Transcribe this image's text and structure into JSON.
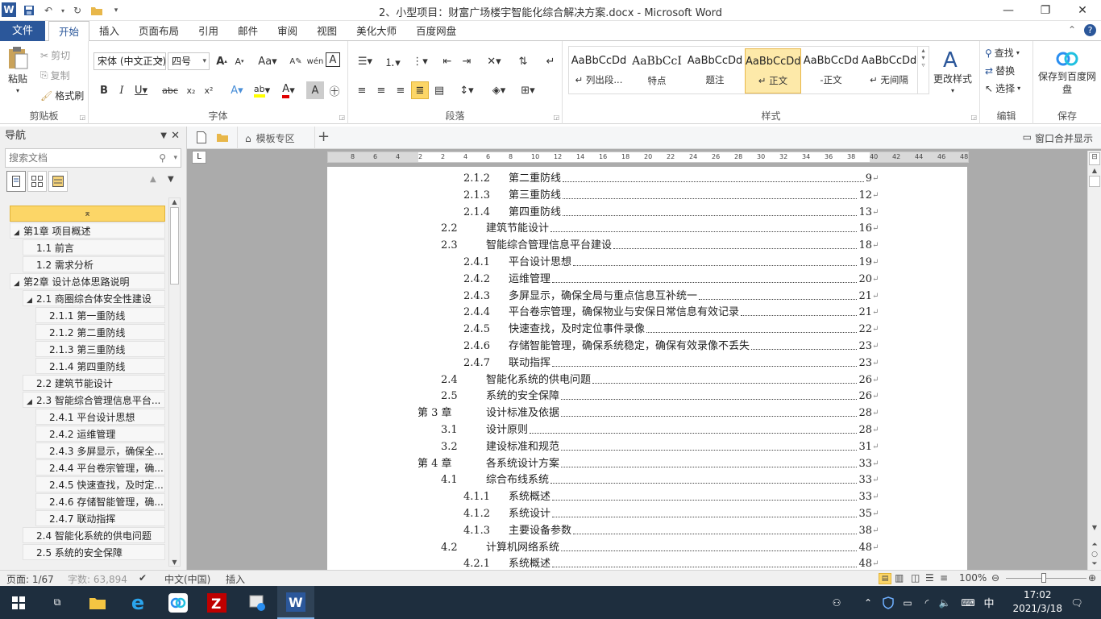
{
  "window": {
    "title": "2、小型项目：财富广场楼宇智能化综合解决方案.docx - Microsoft Word",
    "app_icon": "W"
  },
  "tabs": {
    "file": "文件",
    "items": [
      "开始",
      "插入",
      "页面布局",
      "引用",
      "邮件",
      "审阅",
      "视图",
      "美化大师",
      "百度网盘"
    ],
    "active": "开始"
  },
  "ribbon": {
    "clipboard": {
      "label": "剪贴板",
      "paste": "粘贴",
      "cut": "剪切",
      "copy": "复制",
      "format_painter": "格式刷"
    },
    "font": {
      "label": "字体",
      "name": "宋体 (中文正文)",
      "size": "四号"
    },
    "paragraph": {
      "label": "段落"
    },
    "styles": {
      "label": "样式",
      "items": [
        {
          "preview": "AaBbCcDd",
          "name": "↵ 列出段..."
        },
        {
          "preview": "AaBbCcI",
          "name": "特点"
        },
        {
          "preview": "AaBbCcDd",
          "name": "题注"
        },
        {
          "preview": "AaBbCcDd",
          "name": "↵ 正文"
        },
        {
          "preview": "AaBbCcDd",
          "name": "-正文"
        },
        {
          "preview": "AaBbCcDd",
          "name": "↵ 无间隔"
        }
      ],
      "change_styles": "更改样式"
    },
    "editing": {
      "label": "编辑",
      "find": "查找",
      "replace": "替换",
      "select": "选择"
    },
    "save": {
      "label": "保存",
      "save_to_baidu": "保存到百度网盘"
    }
  },
  "nav": {
    "title": "导航",
    "search_placeholder": "搜索文档",
    "items": [
      {
        "level": 1,
        "text": "第1章 项目概述",
        "expanded": true
      },
      {
        "level": 2,
        "text": "1.1 前言"
      },
      {
        "level": 2,
        "text": "1.2 需求分析"
      },
      {
        "level": 1,
        "text": "第2章 设计总体思路说明",
        "expanded": true
      },
      {
        "level": 2,
        "text": "2.1 商圈综合体安全性建设",
        "expanded": true
      },
      {
        "level": 3,
        "text": "2.1.1 第一重防线"
      },
      {
        "level": 3,
        "text": "2.1.2 第二重防线"
      },
      {
        "level": 3,
        "text": "2.1.3 第三重防线"
      },
      {
        "level": 3,
        "text": "2.1.4 第四重防线"
      },
      {
        "level": 2,
        "text": "2.2 建筑节能设计"
      },
      {
        "level": 2,
        "text": "2.3 智能综合管理信息平台...",
        "expanded": true
      },
      {
        "level": 3,
        "text": "2.4.1 平台设计思想"
      },
      {
        "level": 3,
        "text": "2.4.2 运维管理"
      },
      {
        "level": 3,
        "text": "2.4.3 多屏显示，确保全..."
      },
      {
        "level": 3,
        "text": "2.4.4 平台卷宗管理，确..."
      },
      {
        "level": 3,
        "text": "2.4.5 快速查找，及时定..."
      },
      {
        "level": 3,
        "text": "2.4.6 存储智能管理，确..."
      },
      {
        "level": 3,
        "text": "2.4.7 联动指挥"
      },
      {
        "level": 2,
        "text": "2.4 智能化系统的供电问题"
      },
      {
        "level": 2,
        "text": "2.5 系统的安全保障"
      }
    ]
  },
  "doc_tabs": {
    "template": "模板专区",
    "window_merge": "窗口合并显示"
  },
  "toc": [
    {
      "level": 3,
      "num": "2.1.2",
      "title": "第二重防线",
      "page": "9"
    },
    {
      "level": 3,
      "num": "2.1.3",
      "title": "第三重防线",
      "page": "12"
    },
    {
      "level": 3,
      "num": "2.1.4",
      "title": "第四重防线",
      "page": "13"
    },
    {
      "level": 2,
      "num": "2.2",
      "title": "建筑节能设计",
      "page": "16"
    },
    {
      "level": 2,
      "num": "2.3",
      "title": "智能综合管理信息平台建设",
      "page": "18"
    },
    {
      "level": 3,
      "num": "2.4.1",
      "title": "平台设计思想",
      "page": "19"
    },
    {
      "level": 3,
      "num": "2.4.2",
      "title": "运维管理",
      "page": "20"
    },
    {
      "level": 3,
      "num": "2.4.3",
      "title": "多屏显示，确保全局与重点信息互补统一",
      "page": "21"
    },
    {
      "level": 3,
      "num": "2.4.4",
      "title": "平台卷宗管理，确保物业与安保日常信息有效记录",
      "page": "21"
    },
    {
      "level": 3,
      "num": "2.4.5",
      "title": "快速查找，及时定位事件录像",
      "page": "22"
    },
    {
      "level": 3,
      "num": "2.4.6",
      "title": "存储智能管理，确保系统稳定，确保有效录像不丢失",
      "page": "23"
    },
    {
      "level": 3,
      "num": "2.4.7",
      "title": "联动指挥",
      "page": "23"
    },
    {
      "level": 2,
      "num": "2.4",
      "title": "智能化系统的供电问题",
      "page": "26"
    },
    {
      "level": 2,
      "num": "2.5",
      "title": "系统的安全保障",
      "page": "26"
    },
    {
      "level": 1,
      "num": "第 3 章",
      "title": "设计标准及依据",
      "page": "28"
    },
    {
      "level": 2,
      "num": "3.1",
      "title": "设计原则",
      "page": "28"
    },
    {
      "level": 2,
      "num": "3.2",
      "title": "建设标准和规范",
      "page": "31"
    },
    {
      "level": 1,
      "num": "第 4 章",
      "title": "各系统设计方案",
      "page": "33"
    },
    {
      "level": 2,
      "num": "4.1",
      "title": "综合布线系统",
      "page": "33"
    },
    {
      "level": 3,
      "num": "4.1.1",
      "title": "系统概述",
      "page": "33"
    },
    {
      "level": 3,
      "num": "4.1.2",
      "title": "系统设计",
      "page": "35"
    },
    {
      "level": 3,
      "num": "4.1.3",
      "title": "主要设备参数",
      "page": "38"
    },
    {
      "level": 2,
      "num": "4.2",
      "title": "计算机网络系统",
      "page": "48"
    },
    {
      "level": 3,
      "num": "4.2.1",
      "title": "系统概述",
      "page": "48"
    }
  ],
  "ruler_numbers": [
    "8",
    "6",
    "4",
    "2",
    "2",
    "4",
    "6",
    "8",
    "10",
    "12",
    "14",
    "16",
    "18",
    "20",
    "22",
    "24",
    "26",
    "28",
    "30",
    "32",
    "34",
    "36",
    "38",
    "40",
    "42",
    "44",
    "46",
    "48"
  ],
  "status": {
    "page": "页面: 1/67",
    "words": "字数: 63,894",
    "language": "中文(中国)",
    "mode": "插入",
    "zoom": "100%"
  },
  "taskbar": {
    "time": "17:02",
    "date": "2021/3/18",
    "ime": "中"
  }
}
